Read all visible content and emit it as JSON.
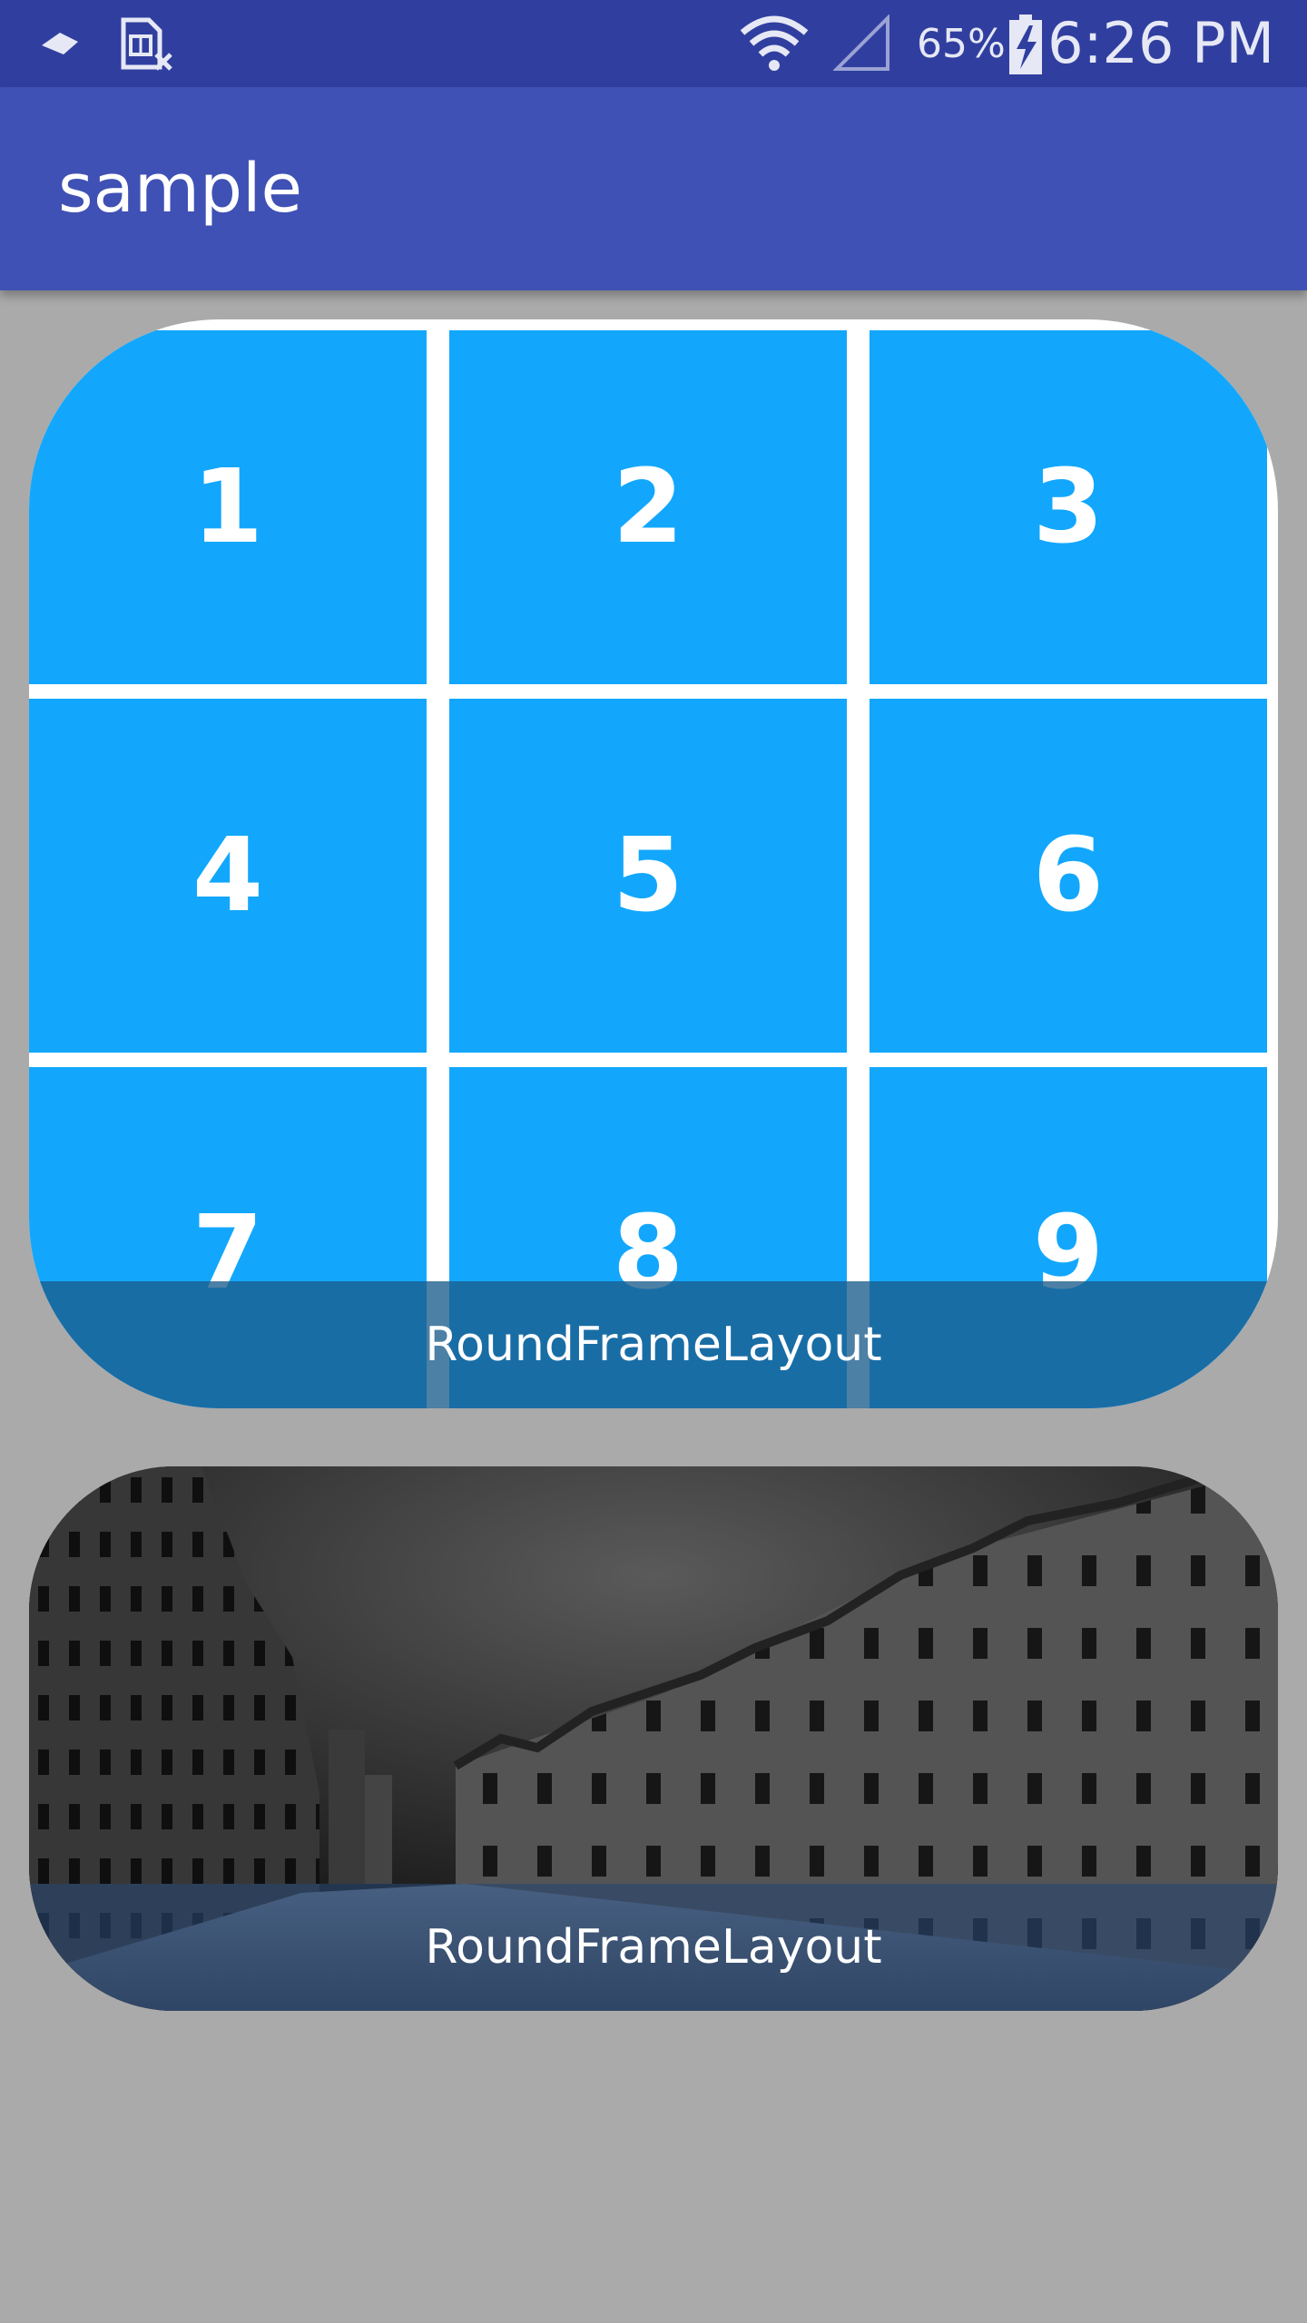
{
  "status_bar": {
    "battery_percent": "65%",
    "time": "6:26 PM",
    "icons": [
      "cloud-icon",
      "sim-error-icon",
      "wifi-icon",
      "signal-icon",
      "battery-charging-icon"
    ]
  },
  "app_bar": {
    "title": "sample"
  },
  "grid_frame": {
    "cells": [
      "1",
      "2",
      "3",
      "4",
      "5",
      "6",
      "7",
      "8",
      "9"
    ],
    "caption": "RoundFrameLayout",
    "cell_color": "#12a7fc"
  },
  "photo_frame": {
    "caption": "RoundFrameLayout",
    "image": "grayscale-canal-warehouses-photo"
  },
  "colors": {
    "status_bar": "#303f9f",
    "app_bar": "#3f51b5",
    "background": "#aaaaaa"
  }
}
